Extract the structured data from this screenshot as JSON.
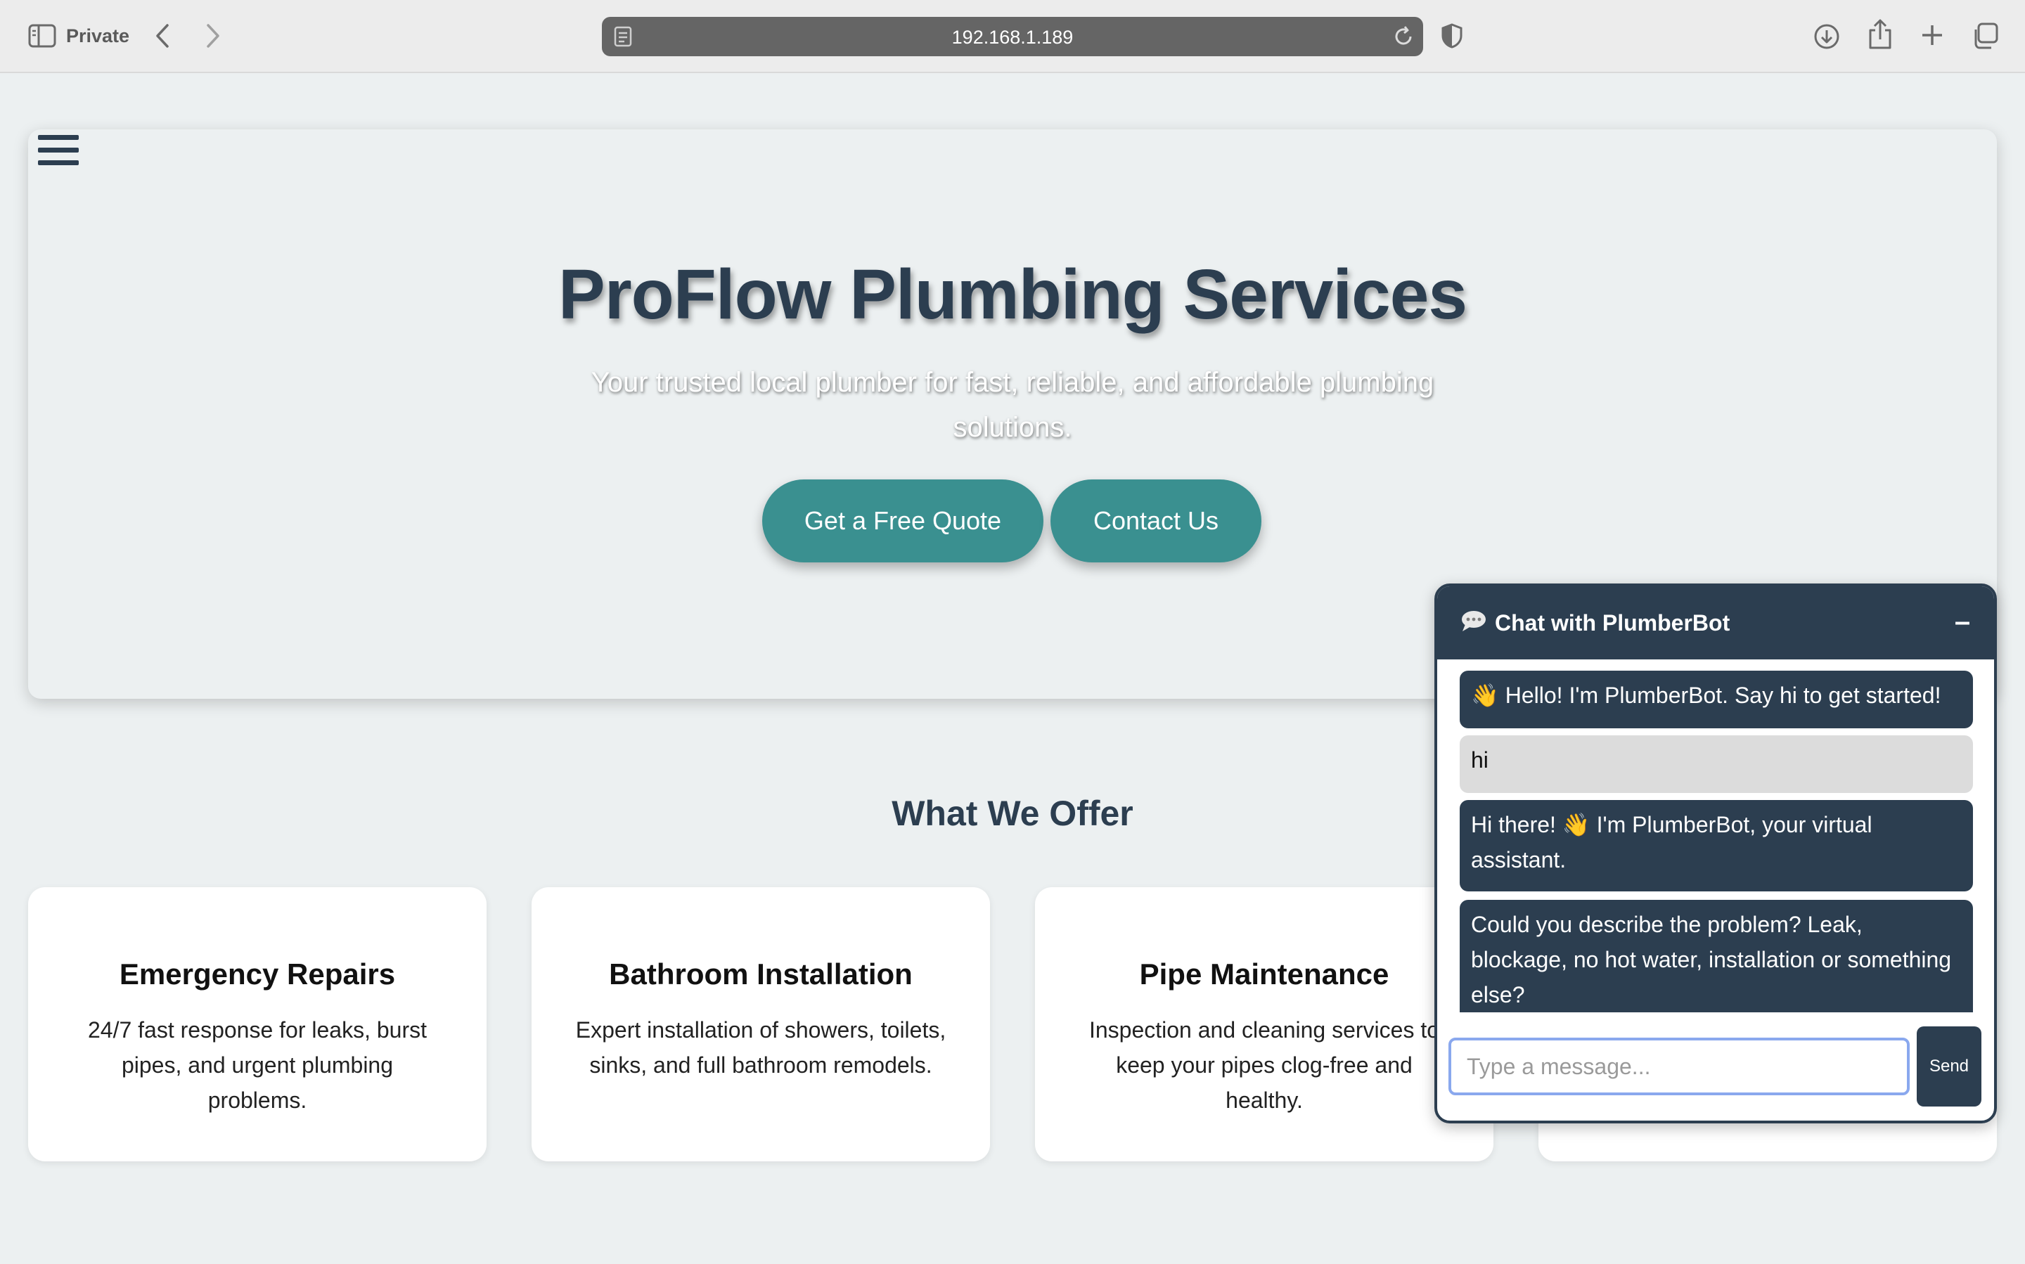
{
  "browser": {
    "private_label": "Private",
    "url": "192.168.1.189"
  },
  "hero": {
    "title": "ProFlow Plumbing Services",
    "subtitle": "Your trusted local plumber for fast, reliable, and affordable plumbing solutions.",
    "quote_button": "Get a Free Quote",
    "contact_button": "Contact Us"
  },
  "offers": {
    "heading": "What We Offer",
    "cards": [
      {
        "title": "Emergency Repairs",
        "desc": "24/7 fast response for leaks, burst pipes, and urgent plumbing problems."
      },
      {
        "title": "Bathroom Installation",
        "desc": "Expert installation of showers, toilets, sinks, and full bathroom remodels."
      },
      {
        "title": "Pipe Maintenance",
        "desc": "Inspection and cleaning services to keep your pipes clog-free and healthy."
      },
      {
        "title": "",
        "desc": ""
      }
    ]
  },
  "chat": {
    "title": "Chat with PlumberBot",
    "minimize_label": "–",
    "messages": [
      {
        "from": "bot",
        "text": "👋 Hello! I'm PlumberBot. Say hi to get started!"
      },
      {
        "from": "user",
        "text": "hi"
      },
      {
        "from": "bot",
        "text": "Hi there! 👋 I'm PlumberBot, your virtual assistant."
      },
      {
        "from": "bot",
        "text": "Could you describe the problem? Leak, blockage, no hot water, installation or something else?"
      }
    ],
    "input_placeholder": "Type a message...",
    "input_value": "",
    "send_label": "Send"
  },
  "colors": {
    "page_bg": "#ecf0f1",
    "navy": "#2c3e50",
    "teal": "#3a9090",
    "input_focus": "#8aa8ee"
  },
  "icons": {
    "sidebar": "sidebar-icon",
    "back": "chevron-left-icon",
    "forward": "chevron-right-icon",
    "page": "page-icon",
    "reload": "reload-icon",
    "shield": "shield-icon",
    "download": "download-icon",
    "share": "share-icon",
    "new_tab": "plus-icon",
    "tabs": "tabs-overview-icon",
    "menu": "hamburger-icon",
    "chat": "speech-bubble-icon"
  }
}
